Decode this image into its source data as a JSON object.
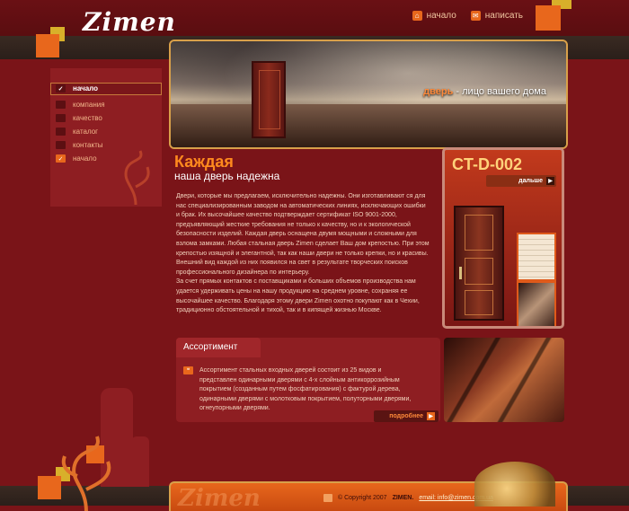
{
  "site": {
    "logo": "Zimen"
  },
  "topnav": [
    {
      "label": "начало",
      "icon": "home-icon"
    },
    {
      "label": "написать",
      "icon": "mail-icon"
    }
  ],
  "banner": {
    "tagline_strong": "дверь",
    "tagline_rest": " - лицо вашего дома"
  },
  "sidebar": {
    "items": [
      {
        "label": "начало",
        "active": true
      },
      {
        "label": "компания",
        "active": false
      },
      {
        "label": "качество",
        "active": false
      },
      {
        "label": "каталог",
        "active": false
      },
      {
        "label": "контакты",
        "active": false
      },
      {
        "label": "начало",
        "active": false
      }
    ]
  },
  "content": {
    "heading": "Каждая",
    "subheading": "наша дверь надежна",
    "paragraphs": [
      "Двери, которые мы предлагаем, исключительно надежны. Они изготавливают ся для нас специализированным заводом на автоматических линиях, исключающих ошибки и брак. Их высочайшее качество подтверждает сертификат ISO 9001-2000, предъявляющий жесткие требования не только к качеству, но и к экологической безопасности изделий. Каждая дверь оснащена двумя мощными и сложными для взлома замками. Любая стальная дверь Zimen сделает Ваш дом крепостью. При этом крепостью изящной и элегантной, так как наши двери не только крепки, но и красивы. Внешний вид каждой из них появился на свет в результате творческих поисков профессионального дизайнера по интерьеру.",
      "За счет прямых контактов с поставщиками и больших объемов производства нам удается удерживать цены на нашу продукцию на среднем уровне, сохраняя ее высочайшее качество. Благодаря этому двери Zimen охотно покупают как в Чехии, традиционно обстоятельной и тихой, так и в кипящей жизнью Москве."
    ]
  },
  "product": {
    "model": "CT-D-002",
    "more_label": "дальше"
  },
  "assortment": {
    "title": "Ассортимент",
    "text": "Ассортимент стальных входных дверей состоит из 25 видов и представлен одинарными дверями с 4-х слойным антикоррозийным покрытием (созданным путем фосфатирования) с фактурой дерева, одинарными дверями с молотковым покрытием, полуторными дверями, огнеупорными дверями.",
    "more_label": "подробнее"
  },
  "footer": {
    "ghost_logo": "Zimen",
    "copyright": "© Copyright 2007",
    "brand": "ZIMEN.",
    "email": "email: info@zimen.com.ua"
  }
}
